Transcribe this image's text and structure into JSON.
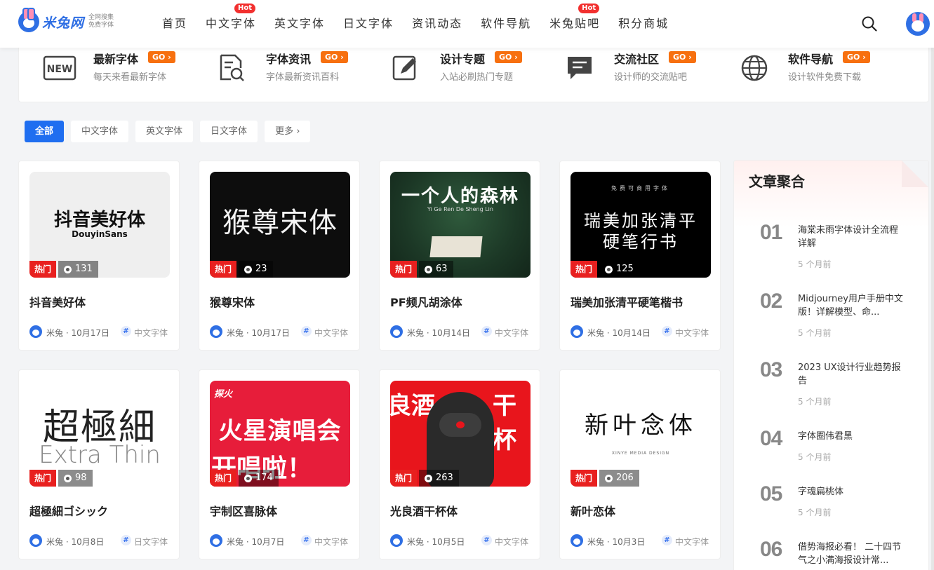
{
  "header": {
    "logo_name": "米兔网",
    "logo_sub_1": "全网搜集",
    "logo_sub_2": "免费字体",
    "nav": [
      {
        "label": "首页",
        "hot": ""
      },
      {
        "label": "中文字体",
        "hot": "Hot"
      },
      {
        "label": "英文字体",
        "hot": ""
      },
      {
        "label": "日文字体",
        "hot": ""
      },
      {
        "label": "资讯动态",
        "hot": ""
      },
      {
        "label": "软件导航",
        "hot": ""
      },
      {
        "label": "米兔贴吧",
        "hot": "Hot"
      },
      {
        "label": "积分商城",
        "hot": ""
      }
    ]
  },
  "quick_links": [
    {
      "title": "最新字体",
      "go": "GO",
      "desc": "每天来看最新字体",
      "icon": "new-icon"
    },
    {
      "title": "字体资讯",
      "go": "GO",
      "desc": "字体最新资讯百科",
      "icon": "document-search-icon"
    },
    {
      "title": "设计专题",
      "go": "GO",
      "desc": "入站必刷热门专题",
      "icon": "edit-icon"
    },
    {
      "title": "交流社区",
      "go": "GO",
      "desc": "设计师的交流贴吧",
      "icon": "chat-icon"
    },
    {
      "title": "软件导航",
      "go": "GO",
      "desc": "设计软件免费下载",
      "icon": "globe-icon"
    }
  ],
  "filters": [
    "全部",
    "中文字体",
    "英文字体",
    "日文字体",
    "更多"
  ],
  "cards": [
    {
      "title": "抖音美好体",
      "views": "131",
      "badge": "热门",
      "author": "米兔",
      "date": "10月17日",
      "category": "中文字体",
      "thumb_main": "抖音美好体",
      "thumb_sub": "DouyinSans"
    },
    {
      "title": "猴尊宋体",
      "views": "23",
      "badge": "热门",
      "author": "米兔",
      "date": "10月17日",
      "category": "中文字体",
      "thumb_main": "猴尊宋体",
      "thumb_sub": ""
    },
    {
      "title": "PF频凡胡涂体",
      "views": "63",
      "badge": "热门",
      "author": "米兔",
      "date": "10月14日",
      "category": "中文字体",
      "thumb_main": "一个人的森林",
      "thumb_sub": "Yi Ge Ren De Sheng Lin"
    },
    {
      "title": "瑞美加张清平硬笔楷书",
      "views": "125",
      "badge": "热门",
      "author": "米兔",
      "date": "10月14日",
      "category": "中文字体",
      "thumb_main": "瑞美加张清平",
      "thumb_sub": "硬笔行书",
      "thumb_top": "免费可商用字体"
    },
    {
      "title": "超極細ゴシック",
      "views": "98",
      "badge": "热门",
      "author": "米兔",
      "date": "10月8日",
      "category": "日文字体",
      "thumb_main": "超極細",
      "thumb_sub": "Extra Thin"
    },
    {
      "title": "宇制区喜脉体",
      "views": "174",
      "badge": "热门",
      "author": "米兔",
      "date": "10月7日",
      "category": "中文字体",
      "thumb_main": "火星演唱会",
      "thumb_sub": "开唱啦！",
      "thumb_top": "探火"
    },
    {
      "title": "光良酒干杯体",
      "views": "263",
      "badge": "热门",
      "author": "米兔",
      "date": "10月5日",
      "category": "中文字体",
      "thumb_main": "良酒",
      "thumb_sub": "干杯"
    },
    {
      "title": "新叶恋体",
      "views": "206",
      "badge": "热门",
      "author": "米兔",
      "date": "10月3日",
      "category": "中文字体",
      "thumb_main": "新叶念体",
      "thumb_sub": "XINYE MEDIA DESIGN"
    }
  ],
  "sidebar": {
    "title": "文章聚合",
    "items": [
      {
        "num": "01",
        "title": "海棠未雨字体设计全流程详解",
        "time": "5 个月前"
      },
      {
        "num": "02",
        "title": "Midjourney用户手册中文版！详解模型、命...",
        "time": "5 个月前"
      },
      {
        "num": "03",
        "title": "2023 UX设计行业趋势报告",
        "time": "5 个月前"
      },
      {
        "num": "04",
        "title": "字体圈伟君黑",
        "time": "5 个月前"
      },
      {
        "num": "05",
        "title": "字魂扁桃体",
        "time": "5 个月前"
      },
      {
        "num": "06",
        "title": "借势海报必看！ 二十四节气之小满海报设计常...",
        "time": ""
      }
    ]
  }
}
